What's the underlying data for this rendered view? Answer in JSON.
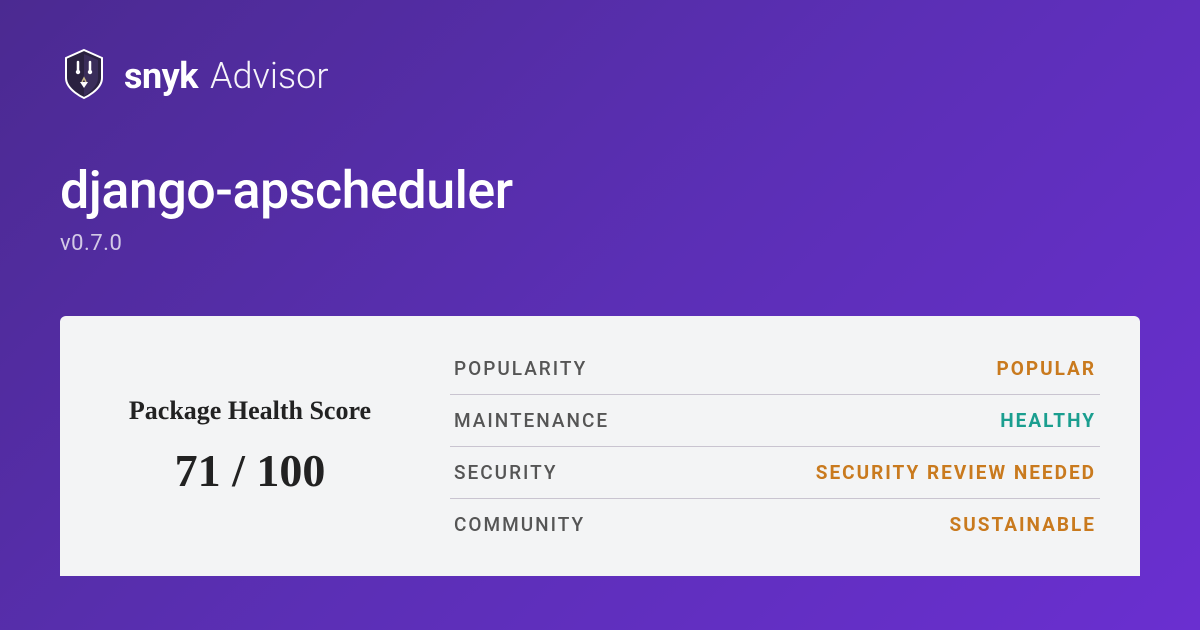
{
  "brand": {
    "name": "snyk",
    "sub": "Advisor"
  },
  "package": {
    "name": "django-apscheduler",
    "version": "v0.7.0"
  },
  "score": {
    "title": "Package Health Score",
    "value": "71 / 100"
  },
  "metrics": {
    "popularity": {
      "label": "POPULARITY",
      "value": "POPULAR",
      "colorClass": "c-orange"
    },
    "maintenance": {
      "label": "MAINTENANCE",
      "value": "HEALTHY",
      "colorClass": "c-green"
    },
    "security": {
      "label": "SECURITY",
      "value": "SECURITY REVIEW NEEDED",
      "colorClass": "c-orange"
    },
    "community": {
      "label": "COMMUNITY",
      "value": "SUSTAINABLE",
      "colorClass": "c-orange"
    }
  }
}
